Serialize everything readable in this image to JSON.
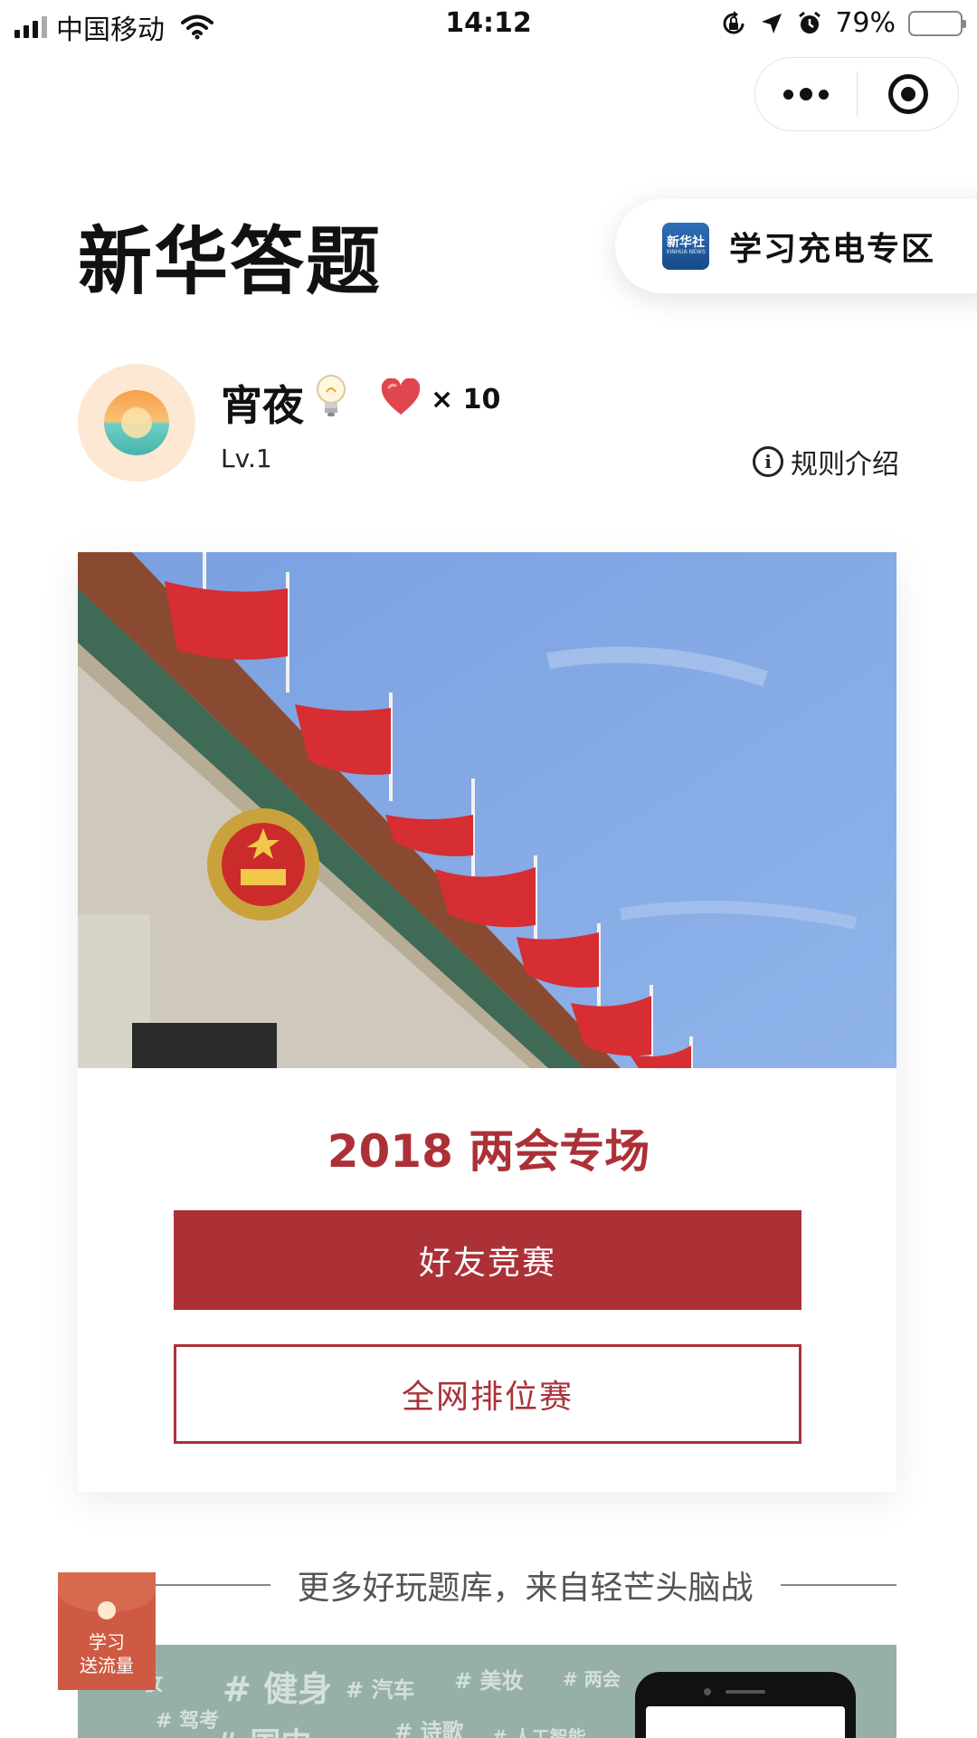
{
  "status_bar": {
    "carrier": "中国移动",
    "time": "14:12",
    "battery": "79%",
    "battery_level": 0.79,
    "icons": [
      "signal-icon",
      "wifi-icon",
      "rotation-lock-icon",
      "location-icon",
      "alarm-icon",
      "battery-icon"
    ]
  },
  "capsule": {
    "icons": [
      "more-icon",
      "close-miniprogram-icon"
    ]
  },
  "header": {
    "title": "新华答题",
    "study_zone": {
      "logo_text": "新华社",
      "logo_subtext": "XINHUA NEWS",
      "label": "学习充电专区"
    }
  },
  "profile": {
    "name": "宵夜",
    "lives_text": "× 10",
    "level": "Lv.1",
    "rules_label": "规则介绍"
  },
  "card": {
    "title": "2018 两会专场",
    "friend_button": "好友竞赛",
    "rank_button": "全网排位赛"
  },
  "more": {
    "text": "更多好玩题库，来自轻芒头脑战",
    "tags": [
      "妆",
      "# 健身",
      "# 汽车",
      "# 美妆",
      "# 两会",
      "# 驾考",
      "# 诗歌",
      "# 人工智能",
      "# 国内"
    ]
  },
  "red_packet": {
    "line1": "学习",
    "line2": "送流量"
  },
  "colors": {
    "accent": "#ab3137",
    "banner": "#97b0a6",
    "battery": "#f5c33b"
  }
}
